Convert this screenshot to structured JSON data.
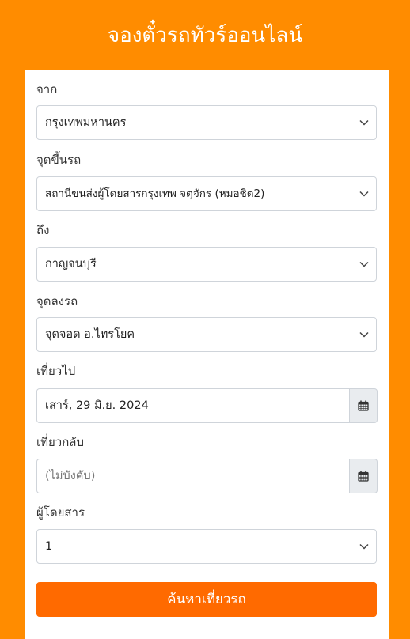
{
  "header": {
    "title": "จองตั๋วรถทัวร์ออนไลน์"
  },
  "form": {
    "from": {
      "label": "จาก",
      "value": "กรุงเทพมหานคร",
      "icon": "chevron-down-icon"
    },
    "boarding_point": {
      "label": "จุดขึ้นรถ",
      "value": "สถานีขนส่งผู้โดยสารกรุงเทพ จตุจักร (หมอชิต2)",
      "icon": "chevron-down-icon"
    },
    "to": {
      "label": "ถึง",
      "value": "กาญจนบุรี",
      "icon": "chevron-down-icon"
    },
    "dropoff_point": {
      "label": "จุดลงรถ",
      "value": "จุดจอด อ.ไทรโยค",
      "icon": "chevron-down-icon"
    },
    "depart_date": {
      "label": "เที่ยวไป",
      "value": "เสาร์, 29 มิ.ย. 2024",
      "icon": "calendar-icon"
    },
    "return_date": {
      "label": "เที่ยวกลับ",
      "value": "",
      "placeholder": "(ไม่บังคับ)",
      "icon": "calendar-icon"
    },
    "passengers": {
      "label": "ผู้โดยสาร",
      "value": "1",
      "icon": "chevron-down-icon"
    },
    "search_button_label": "ค้นหาเที่ยวรถ"
  },
  "colors": {
    "background": "#ff8c00",
    "button": "#ff6a00",
    "card": "#ffffff"
  }
}
